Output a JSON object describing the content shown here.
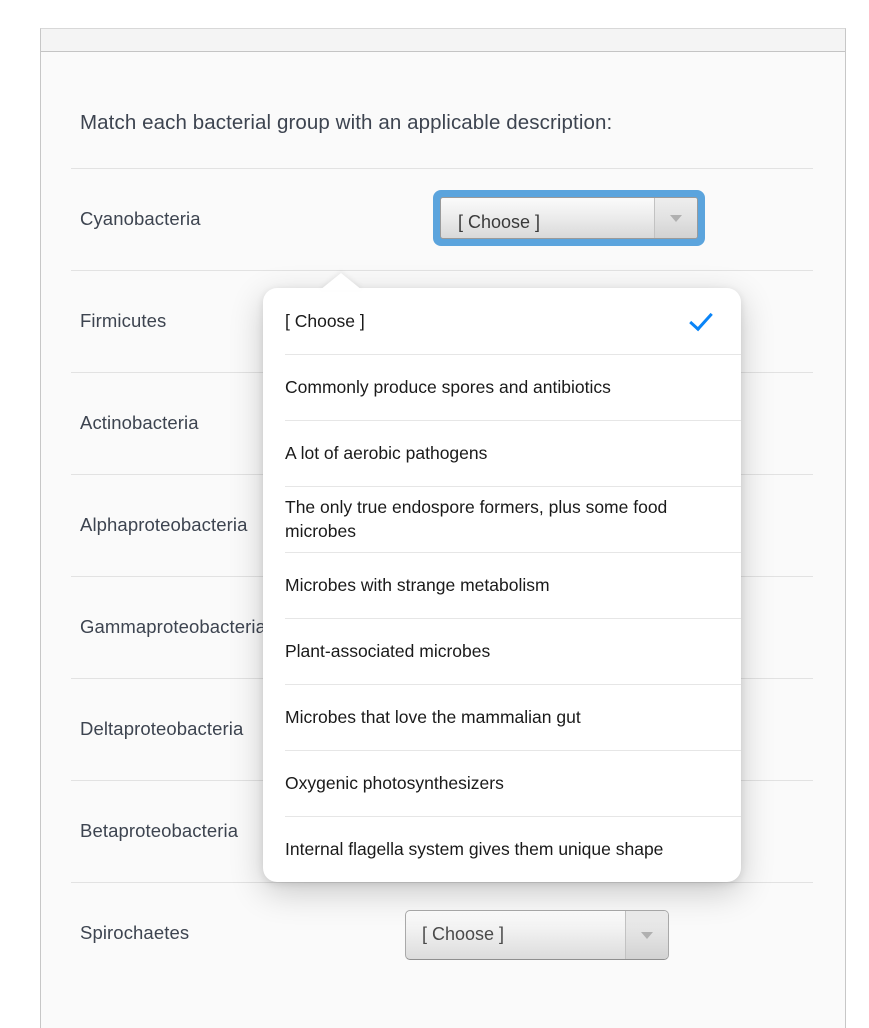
{
  "panel": {
    "header_strip": ""
  },
  "prompt": "Match each bacterial group with an applicable description:",
  "select": {
    "placeholder_value": "[ Choose ]",
    "arrow_icon": "chevron-down-icon"
  },
  "rows": [
    {
      "label": "Cyanobacteria",
      "value": "[ Choose ]",
      "focused": true
    },
    {
      "label": "Firmicutes",
      "value": "[ Choose ]",
      "focused": false
    },
    {
      "label": "Actinobacteria",
      "value": "[ Choose ]",
      "focused": false
    },
    {
      "label": "Alphaproteobacteria",
      "value": "[ Choose ]",
      "focused": false
    },
    {
      "label": "Gammaproteobacteria",
      "value": "[ Choose ]",
      "focused": false
    },
    {
      "label": "Deltaproteobacteria",
      "value": "[ Choose ]",
      "focused": false
    },
    {
      "label": "Betaproteobacteria",
      "value": "[ Choose ]",
      "focused": false
    },
    {
      "label": "Spirochaetes",
      "value": "[ Choose ]",
      "focused": false
    }
  ],
  "dropdown": {
    "selected_index": 0,
    "check_icon": "checkmark-icon",
    "options": [
      "[ Choose ]",
      "Commonly produce spores and antibiotics",
      "A lot of aerobic pathogens",
      "The only true endospore formers, plus some food microbes",
      "Microbes with strange metabolism",
      "Plant-associated microbes",
      "Microbes that love the mammalian gut",
      "Oxygenic photosynthesizers",
      "Internal flagella system gives them unique shape"
    ]
  },
  "colors": {
    "accent_focus_ring": "#5ba4dd",
    "accent_check": "#0a84f7",
    "label_text": "#3d4450",
    "panel_bg": "#fafafa",
    "popup_bg": "#ffffff"
  }
}
